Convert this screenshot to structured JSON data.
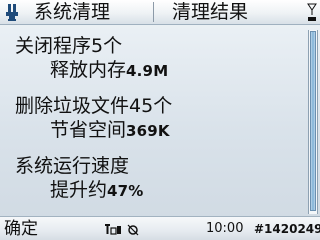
{
  "titlebar": {
    "app_title": "系统清理",
    "view_title": "清理结果",
    "app_icon": "app-icon",
    "signal_icon": "signal-icon"
  },
  "results": [
    {
      "label": "关闭程序",
      "value": "5个"
    },
    {
      "label": "释放内存",
      "value": "4.9M"
    },
    {
      "label": "删除垃圾文件",
      "value": "45个"
    },
    {
      "label": "节省空间",
      "value": "369K"
    },
    {
      "label": "系统运行速度",
      "value": ""
    },
    {
      "label": "提升约",
      "value": "47%"
    }
  ],
  "softbar": {
    "left_softkey": "确定",
    "status_icons": "status-icons",
    "clock": "10:00",
    "watermark": "#1420249"
  }
}
